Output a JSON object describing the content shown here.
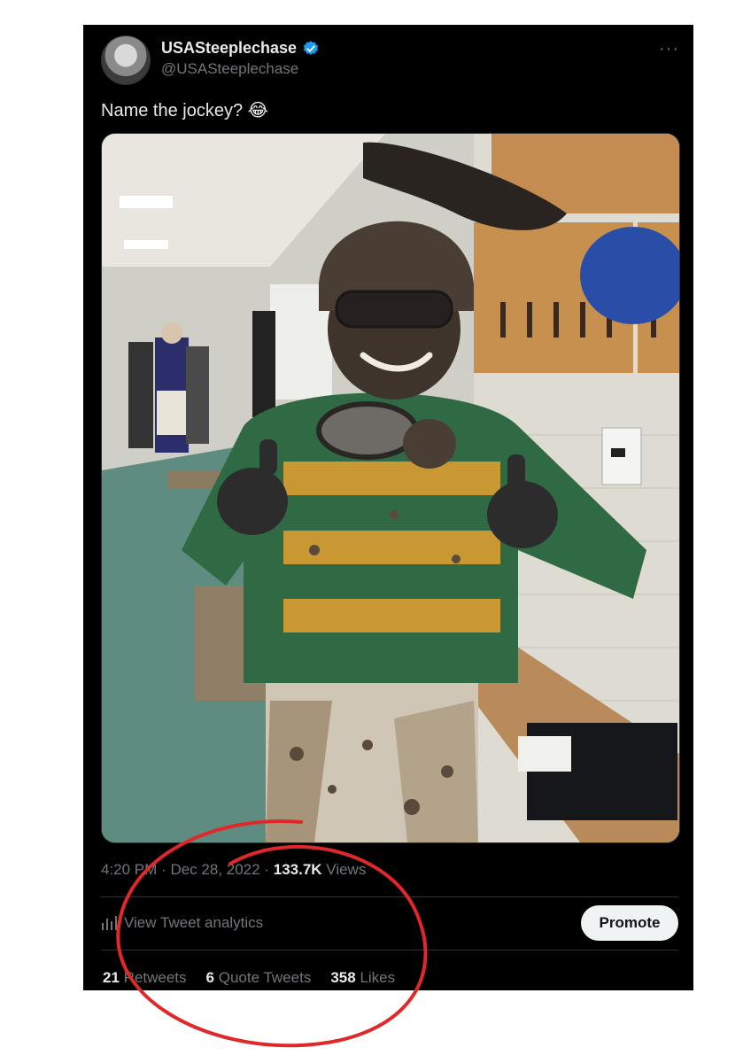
{
  "tweet": {
    "display_name": "USASteeplechase",
    "handle": "@USASteeplechase",
    "more_icon": "···",
    "text": "Name the jockey?",
    "emoji": "😂",
    "time": "4:20 PM",
    "separator": "·",
    "date": "Dec 28, 2022",
    "views_count": "133.7K",
    "views_label": "Views"
  },
  "analytics": {
    "label": "View Tweet analytics"
  },
  "promote": {
    "label": "Promote"
  },
  "stats": {
    "retweets_count": "21",
    "retweets_label": "Retweets",
    "quotes_count": "6",
    "quotes_label": "Quote Tweets",
    "likes_count": "358",
    "likes_label": "Likes"
  },
  "colors": {
    "background": "#000000",
    "text_primary": "#e7e9ea",
    "text_secondary": "#71767b",
    "verified_blue": "#1d9bf0",
    "annotation_red": "#e0282a"
  },
  "icons": [
    "verified-badge-icon",
    "more-icon",
    "analytics-icon"
  ]
}
